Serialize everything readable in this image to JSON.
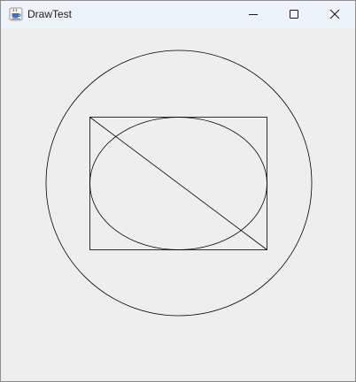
{
  "window": {
    "title": "DrawTest",
    "icon": "java-cup-icon",
    "controls": [
      "minimize-icon",
      "maximize-icon",
      "close-icon"
    ]
  },
  "canvas": {
    "background": "#eeeeee",
    "stroke": "#000000",
    "shapes": [
      "circle",
      "rectangle",
      "ellipse",
      "diagonal-line"
    ]
  }
}
